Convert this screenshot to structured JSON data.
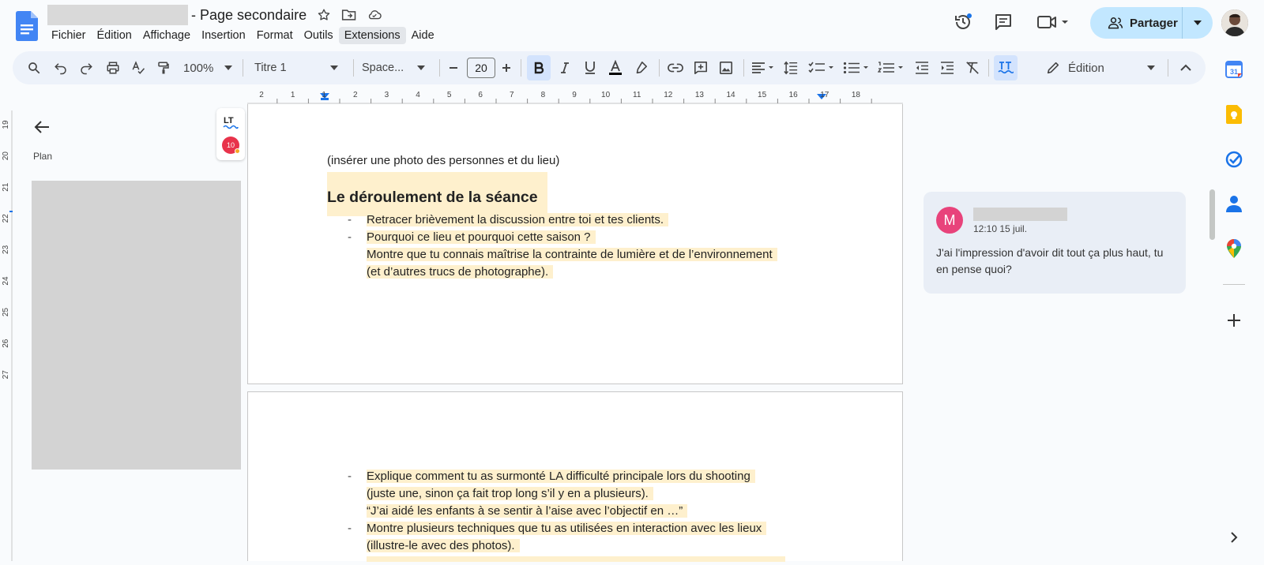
{
  "doc": {
    "title_suffix": "- Page secondaire"
  },
  "menu": [
    "Fichier",
    "Édition",
    "Affichage",
    "Insertion",
    "Format",
    "Outils",
    "Extensions",
    "Aide"
  ],
  "share": {
    "label": "Partager"
  },
  "toolbar": {
    "zoom": "100%",
    "style": "Titre 1",
    "font": "Space...",
    "font_size": "20",
    "mode": "Édition"
  },
  "ruler_ticks": [
    "2",
    "1",
    "1",
    "2",
    "3",
    "4",
    "5",
    "6",
    "7",
    "8",
    "9",
    "10",
    "11",
    "12",
    "13",
    "14",
    "15",
    "16",
    "17",
    "18"
  ],
  "left_ruler_ticks": [
    "19",
    "20",
    "21",
    "22",
    "23",
    "24",
    "25",
    "26",
    "27"
  ],
  "outline": {
    "label": "Plan"
  },
  "lt_widget": {
    "logo": "LT",
    "badge": "10"
  },
  "page1": {
    "note": "(insérer une photo des personnes et du lieu)",
    "heading": "Le déroulement de la séance",
    "lines": [
      "Retracer brièvement la discussion entre toi et tes clients.",
      "Pourquoi ce lieu et pourquoi cette saison ?",
      "Montre que tu connais maîtrise la contrainte de lumière et de l’environnement",
      "(et d’autres trucs de photographe)."
    ]
  },
  "page2": {
    "lines": [
      "Explique comment tu as surmonté LA difficulté principale lors du shooting",
      "(juste une, sinon ça fait trop long s’il y en a plusieurs).",
      "“J’ai aidé les enfants à se sentir à l’aise avec l’objectif en …”",
      "Montre plusieurs techniques que tu as utilisées en interaction avec les lieux",
      "(illustre-le avec des photos)."
    ]
  },
  "bullet_char": "-",
  "comment": {
    "avatar_letter": "M",
    "time": "12:10 15 juil.",
    "body": "J'ai l'impression d'avoir dit tout ça plus haut, tu en pense quoi?"
  },
  "colors": {
    "highlight": "#fef0cd",
    "toolbar_bg": "#edf2fa",
    "share_bg": "#c2e7ff",
    "comment_avatar": "#e8437b",
    "docs_blue": "#4285f4"
  }
}
